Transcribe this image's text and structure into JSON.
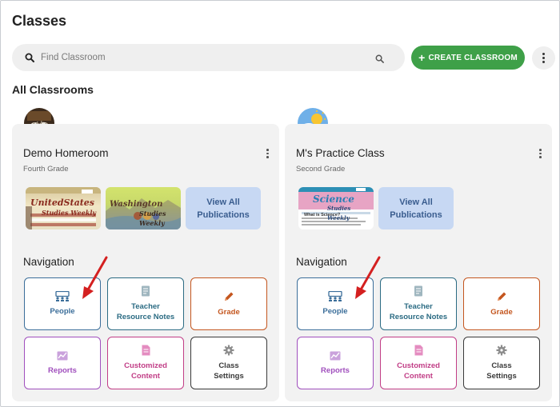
{
  "page": {
    "title": "Classes",
    "section_title": "All Classrooms"
  },
  "search": {
    "placeholder": "Find Classroom",
    "value": ""
  },
  "toolbar": {
    "create_label": "CREATE CLASSROOM",
    "create_icon": "plus-icon",
    "more_icon": "vertical-dots-icon"
  },
  "colors": {
    "create_green": "#3ea048",
    "people_blue": "#3b6e9a",
    "resource_teal": "#2b6b83",
    "grade_orange": "#c4561f",
    "reports_purple": "#a04fbd",
    "content_magenta": "#c13d86",
    "settings_gray": "#3a3a3a",
    "view_all_bg": "#c7d8f3",
    "arrow_red": "#d42020"
  },
  "classes": [
    {
      "name": "Demo Homeroom",
      "grade": "Fourth Grade",
      "avatar": "hands-photo-avatar",
      "publications": [
        {
          "title": "UnitedStates",
          "subtitle": "Studies Weekly"
        },
        {
          "title": "Washington",
          "subtitle": "Studies Weekly"
        }
      ],
      "view_all_label": "View All Publications",
      "navigation_label": "Navigation",
      "tiles": {
        "people": "People",
        "teacher_resource_notes": "Teacher Resource Notes",
        "grade": "Grade",
        "reports": "Reports",
        "customized_content": "Customized Content",
        "class_settings": "Class Settings"
      }
    },
    {
      "name": "M's Practice Class",
      "grade": "Second Grade",
      "avatar": "sun-cloud-avatar",
      "publications": [
        {
          "title": "Science",
          "subtitle": "Studies Weekly",
          "heading": "What is Science?"
        }
      ],
      "view_all_label": "View All Publications",
      "navigation_label": "Navigation",
      "tiles": {
        "people": "People",
        "teacher_resource_notes": "Teacher Resource Notes",
        "grade": "Grade",
        "reports": "Reports",
        "customized_content": "Customized Content",
        "class_settings": "Class Settings"
      }
    }
  ]
}
